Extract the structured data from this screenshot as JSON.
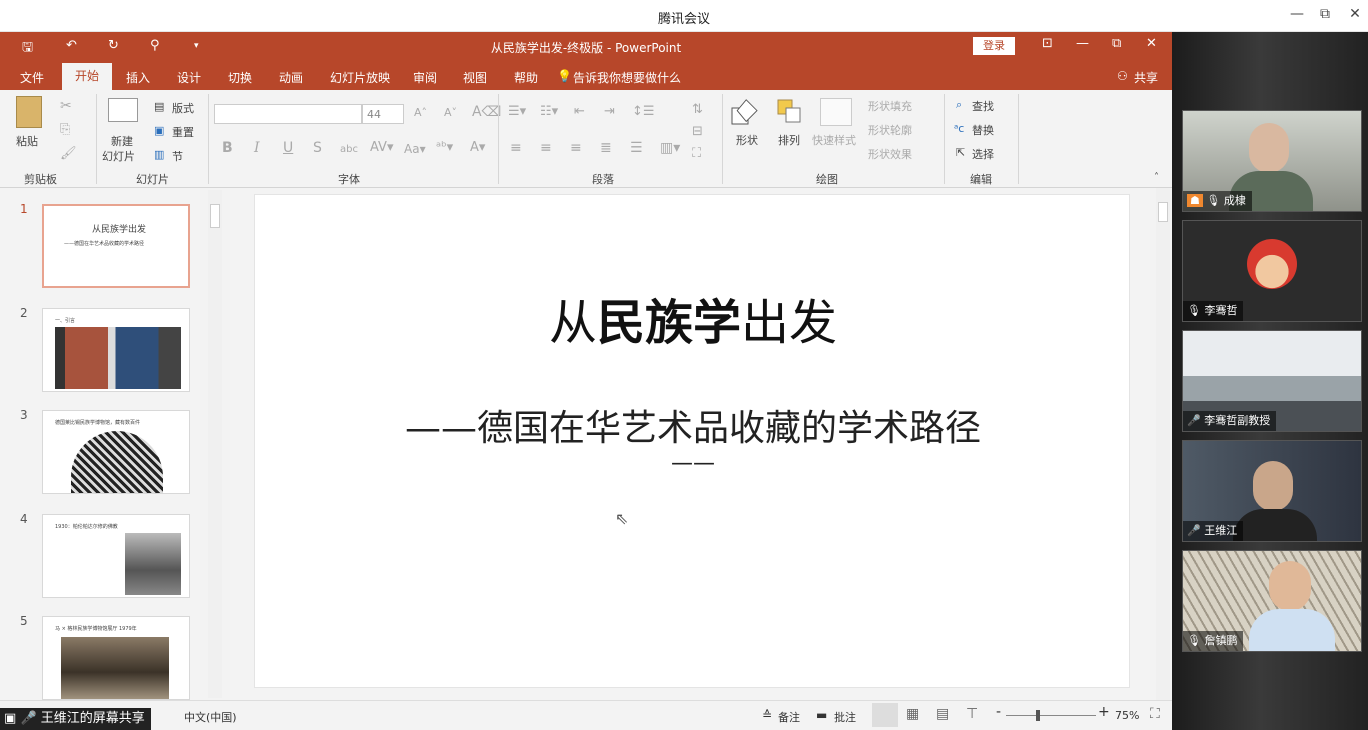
{
  "window": {
    "title": "腾讯会议",
    "minimize": "—",
    "restore": "⧉",
    "close": "✕"
  },
  "ppt": {
    "qat": {
      "save": "🖫",
      "undo": "↶",
      "redo": "↻",
      "present": "⚲",
      "more": "▾"
    },
    "doc_title": "从民族学出发-终极版 - PowerPoint",
    "login": "登录",
    "tabs": [
      "文件",
      "开始",
      "插入",
      "设计",
      "切换",
      "动画",
      "幻灯片放映",
      "审阅",
      "视图",
      "帮助"
    ],
    "tell_me": "告诉我你想要做什么",
    "share": "共享",
    "ribbon": {
      "paste": "粘贴",
      "new_slide": "新建",
      "new_slide2": "幻灯片",
      "layout": "版式",
      "reset": "重置",
      "section": "节",
      "font_size": "44",
      "bold": "B",
      "italic": "I",
      "underline": "U",
      "strike": "S",
      "shadow": "abc",
      "shape": "形状",
      "arrange": "排列",
      "quick_style": "快速样式",
      "shape_fill": "形状填充",
      "shape_outline": "形状轮廓",
      "shape_effect": "形状效果",
      "find": "查找",
      "replace": "替换",
      "select": "选择",
      "groups": {
        "clipboard": "剪贴板",
        "slides": "幻灯片",
        "font": "字体",
        "paragraph": "段落",
        "drawing": "绘图",
        "editing": "编辑"
      }
    },
    "thumbs": [
      {
        "num": "1",
        "title": "从民族学出发",
        "sub": "——德国在华艺术品收藏的学术路径"
      },
      {
        "num": "2",
        "title": "一、引言"
      },
      {
        "num": "3",
        "title": "德国莱比锡民族学博物馆，藏有数百件"
      },
      {
        "num": "4",
        "title": "1930：帕伦帕达尔修的佛教"
      },
      {
        "num": "5",
        "title": "马 × 格林民族学博物馆展厅 1979年"
      }
    ],
    "slide": {
      "title_a": "从",
      "title_b": "民族学",
      "title_c": "出发",
      "subtitle": "——德国在华艺术品收藏的学术路径",
      "dash": "——"
    },
    "status": {
      "lang": "中文(中国)",
      "notes": "备注",
      "comments": "批注",
      "zoom": "75%"
    }
  },
  "participants": [
    {
      "name": "成棣",
      "icon": "mic-active-icon"
    },
    {
      "name": "李骞哲",
      "icon": "mic-active-icon"
    },
    {
      "name": "李骞哲副教授",
      "icon": "mic-icon"
    },
    {
      "name": "王维江",
      "icon": "mic-icon"
    },
    {
      "name": "詹镇鹏",
      "icon": "mic-active-icon"
    }
  ],
  "share_tag": "王维江的屏幕共享",
  "colors": {
    "ppt_red": "#b7472a",
    "panel_bg": "#222222"
  }
}
